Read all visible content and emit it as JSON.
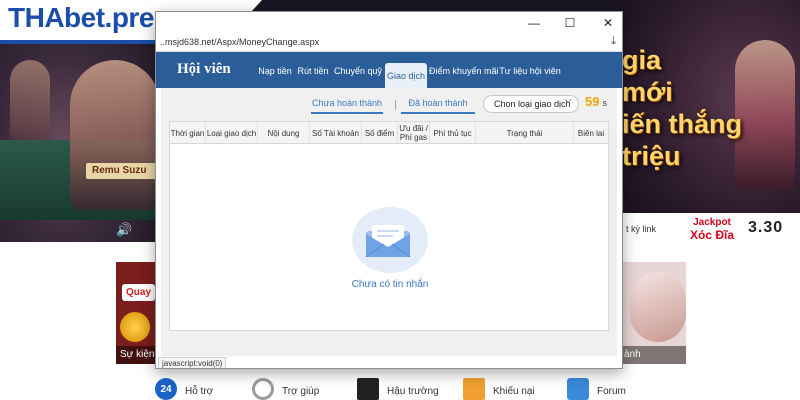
{
  "site": {
    "logo_tha": "THA",
    "logo_bet": "bet.press",
    "dealer_name": "Remu Suzu",
    "promo_lines": [
      "gia",
      "mới",
      "iến thắng",
      "triệu"
    ],
    "bottom_link": "t kỳ link",
    "jackpot_line1": "Jackpot",
    "jackpot_line2": "Xóc Đĩa",
    "jackpot_value": "3.30",
    "card_left_pill": "Quay",
    "card_left_caption": "Sự kiện",
    "card_right_caption": "ảnh",
    "footer_nav": [
      {
        "icon_text": "24",
        "label": "Hỗ trợ",
        "color": "#1a64c8"
      },
      {
        "icon_text": "",
        "label": "Trợ giúp",
        "color": "#9a9a9a"
      },
      {
        "icon_text": "",
        "label": "Hậu trường",
        "color": "#222222"
      },
      {
        "icon_text": "",
        "label": "Khiếu nại",
        "color": "#f0a030"
      },
      {
        "icon_text": "",
        "label": "Forum",
        "color": "#3a8ad8"
      }
    ]
  },
  "popup": {
    "url": "..msjd638.net/Aspx/MoneyChange.aspx",
    "controls": {
      "minimize": "—",
      "maximize": "☐",
      "close": "✕"
    },
    "brand": "Hội viên",
    "tabs": [
      {
        "label": "Nạp tiền"
      },
      {
        "label": "Rút tiền"
      },
      {
        "label": "Chuyển quỹ"
      },
      {
        "label": "Giao dịch",
        "active": true
      },
      {
        "label": "Điểm khuyến mãi"
      },
      {
        "label": "Tư liệu hội viên"
      }
    ],
    "subtabs": {
      "pending": "Chưa hoàn thành",
      "done": "Đã hoàn thành"
    },
    "select_label": "Chọn loại giao dịch",
    "countdown_value": "59",
    "countdown_unit": "s",
    "columns": [
      "Thời gian",
      "Loại giao dịch",
      "Nội dung",
      "Số Tài khoản",
      "Số điểm",
      "Ưu đãi / Phí gas",
      "Phí thủ tục",
      "Trạng thái",
      "Biên lai"
    ],
    "empty_text": "Chưa có tin nhắn",
    "status_text": "javascript:void(0)"
  },
  "colors": {
    "nav_blue": "#2b5d99",
    "link_blue": "#3a78c2",
    "countdown": "#f2a300"
  }
}
